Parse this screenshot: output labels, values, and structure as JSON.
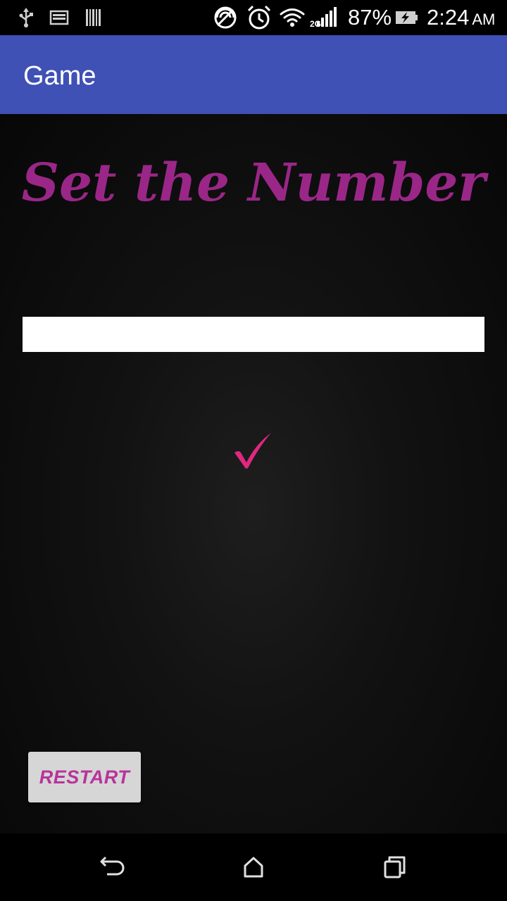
{
  "status_bar": {
    "battery_percent": "87%",
    "time": "2:24",
    "ampm": "AM",
    "icons": [
      "usb-icon",
      "image-icon",
      "barcode-icon",
      "no-sim-icon",
      "alarm-icon",
      "wifi-icon",
      "signal-icon",
      "battery-charging-icon"
    ]
  },
  "app_bar": {
    "title": "Game",
    "color": "#3F51B5"
  },
  "main": {
    "headline": "Set the Number",
    "headline_color": "#9A2787",
    "number_input": {
      "value": "",
      "placeholder": ""
    },
    "check_icon": "checkmark-icon",
    "check_color": "#E0287F",
    "restart_label": "RESTART",
    "restart_color": "#B7349B"
  },
  "nav_bar": {
    "icons": [
      "back-icon",
      "home-icon",
      "recents-icon"
    ]
  }
}
